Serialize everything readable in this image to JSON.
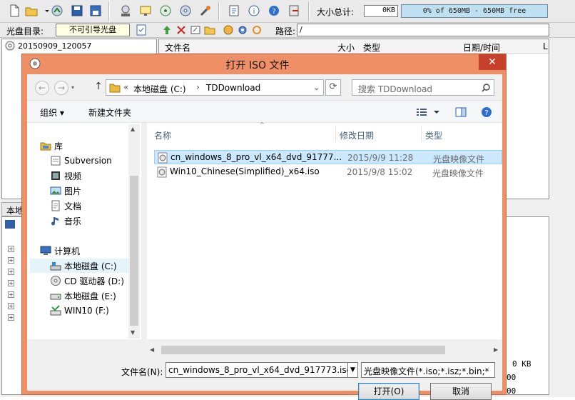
{
  "toolbar": {
    "size_label": "大小总计:",
    "size_value": "0KB",
    "capacity_text": "0% of 650MB - 650MB free",
    "icons": [
      "new-icon",
      "open-icon",
      "extract-icon",
      "save-icon",
      "saveas-icon",
      "mount-icon",
      "burn-icon",
      "compress-icon",
      "virtual-drive-icon",
      "tools-icon",
      "properties-icon",
      "info-icon",
      "help-icon",
      "exit-icon"
    ]
  },
  "disc_bar": {
    "label": "光盘目录:",
    "boot_status": "不可引导光盘",
    "path_label": "路径:",
    "path_value": "/"
  },
  "disc_tree": {
    "root": "20150909_120057"
  },
  "file_list_header": {
    "name": "文件名",
    "size": "大小",
    "type": "类型",
    "date": "日期/时间",
    "extra": "L"
  },
  "local_tab": "本地",
  "bg_values": {
    "kb": "0 KB",
    "v1": "00",
    "v2": "00"
  },
  "dialog": {
    "title": "打开 ISO 文件",
    "close": "✕",
    "address": {
      "prefix": "«",
      "segment1": "本地磁盘 (C:)",
      "separator": "›",
      "segment2": "TDDownload"
    },
    "search_placeholder": "搜索 TDDownload",
    "organize": "组织 ▾",
    "new_folder": "新建文件夹",
    "nav": [
      {
        "label": "库",
        "icon": "library-icon"
      },
      {
        "label": "Subversion",
        "icon": "svn-icon"
      },
      {
        "label": "视频",
        "icon": "video-icon"
      },
      {
        "label": "图片",
        "icon": "picture-icon"
      },
      {
        "label": "文档",
        "icon": "document-icon"
      },
      {
        "label": "音乐",
        "icon": "music-icon"
      },
      {
        "label": "计算机",
        "icon": "computer-icon"
      },
      {
        "label": "本地磁盘 (C:)",
        "icon": "drive-c-icon"
      },
      {
        "label": "CD 驱动器 (D:)",
        "icon": "cd-drive-icon"
      },
      {
        "label": "本地磁盘 (E:)",
        "icon": "drive-e-icon"
      },
      {
        "label": "WIN10 (F:)",
        "icon": "win10-drive-icon"
      }
    ],
    "columns": {
      "name": "名称",
      "date": "修改日期",
      "type": "类型"
    },
    "files": [
      {
        "name": "cn_windows_8_pro_vl_x64_dvd_91777...",
        "date": "2015/9/9 11:28",
        "type": "光盘映像文件"
      },
      {
        "name": "Win10_Chinese(Simplified)_x64.iso",
        "date": "2015/9/8 15:02",
        "type": "光盘映像文件"
      }
    ],
    "filename_label": "文件名(N):",
    "filename_value": "cn_windows_8_pro_vl_x64_dvd_917773.iso",
    "filter_value": "光盘映像文件(*.iso;*.isz;*.bin;*",
    "open_button": "打开(O)",
    "cancel_button": "取消"
  }
}
